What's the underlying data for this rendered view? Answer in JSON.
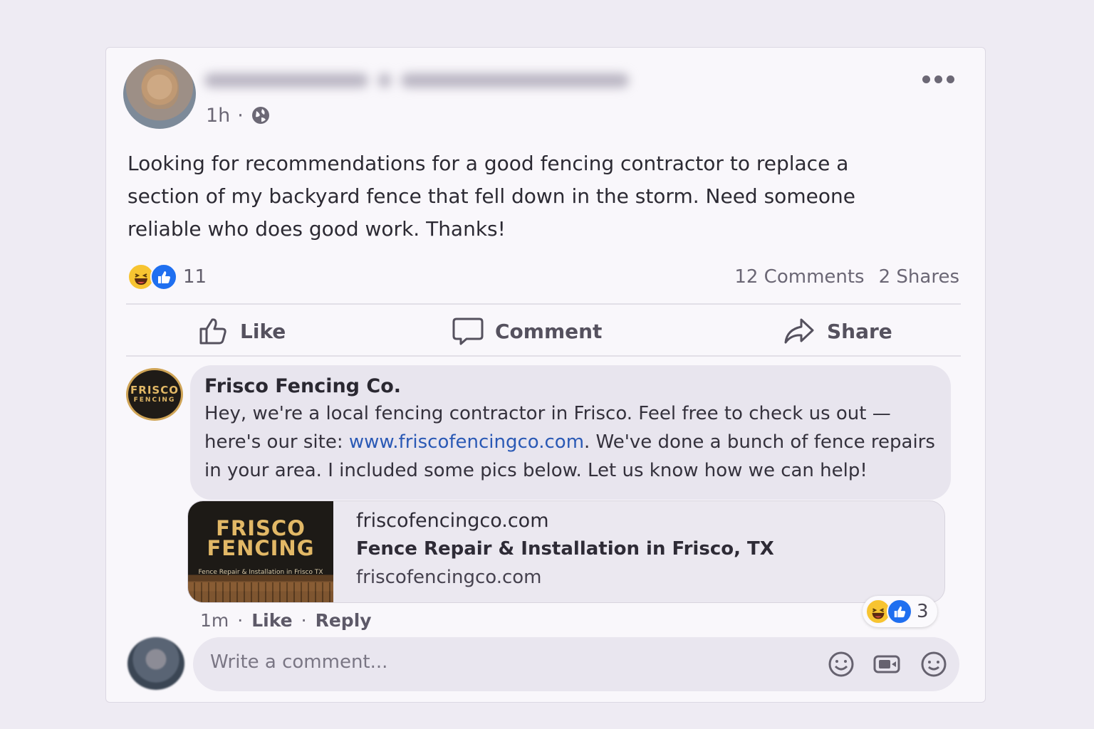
{
  "post": {
    "time": "1h",
    "separator": "·",
    "audience_icon": "globe-icon",
    "text": "Looking for recommendations for a good fencing contractor to replace a section of my backyard fence that fell down in the storm. Need someone reliable who does good work. Thanks!",
    "reaction_count": "11",
    "comments": "12 Comments",
    "shares": "2 Shares"
  },
  "actions": {
    "like": "Like",
    "comment": "Comment",
    "share": "Share"
  },
  "comment": {
    "avatar_line1": "FRISCO",
    "avatar_line2": "FENCING",
    "author": "Frisco Fencing Co.",
    "text_before": "Hey, we're a local fencing contractor in Frisco. Feel free to check us out — here's our site: ",
    "link": "www.friscofencingco.com",
    "text_after": ". We've done a bunch of fence repairs in your area. I included some pics below. Let us know how we can help!",
    "preview": {
      "thumb_line1": "FRISCO",
      "thumb_line2": "FENCING",
      "thumb_caption": "Fence Repair & Installation in Frisco TX",
      "domain": "friscofencingco.com",
      "title": "Fence Repair & Installation in Frisco, TX",
      "url": "friscofencingco.com"
    },
    "reaction_count": "3",
    "time": "1m",
    "like": "Like",
    "reply": "Reply"
  },
  "composer": {
    "placeholder": "Write a comment...",
    "icons": [
      "emoji-icon",
      "gif-icon",
      "sticker-icon"
    ]
  },
  "colors": {
    "background": "#eeebf3",
    "card": "#f9f7fb",
    "link": "#2a59b5",
    "like_blue": "#1f6ff0",
    "haha_yellow": "#f7c431",
    "brand_gold": "#e2b866"
  }
}
